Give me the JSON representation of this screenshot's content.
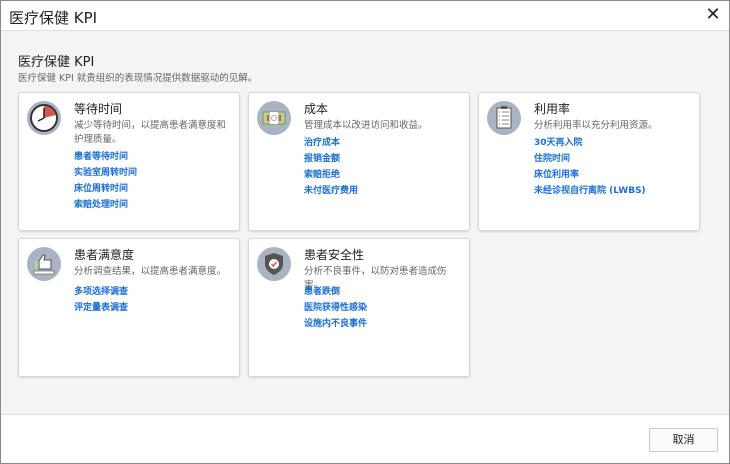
{
  "window": {
    "title": "医疗保健 KPI",
    "close_icon": "close-icon"
  },
  "header": {
    "title": "医疗保健 KPI",
    "subtitle": "医疗保健 KPI 就贵组织的表现情况提供数据驱动的见解。"
  },
  "cards": [
    {
      "title": "等待时间",
      "description": "减少等待时间，以提高患者满意度和护理质量。",
      "icon": "clock-icon",
      "links": [
        "患者等待时间",
        "实验室周转时间",
        "床位周转时间",
        "索赔处理时间"
      ]
    },
    {
      "title": "成本",
      "description": "管理成本以改进访问和收益。",
      "icon": "money-icon",
      "links": [
        "治疗成本",
        "报销金额",
        "索赔拒绝",
        "未付医疗费用"
      ]
    },
    {
      "title": "利用率",
      "description": "分析利用率以充分利用资源。",
      "icon": "clipboard-icon",
      "links": [
        "30天再入院",
        "住院时间",
        "床位利用率",
        "未经诊视自行离院 (LWBS)"
      ]
    },
    {
      "title": "患者满意度",
      "description": "分析调查结果，以提高患者满意度。",
      "icon": "thumbs-up-icon",
      "links": [
        "多项选择调查",
        "评定量表调查"
      ]
    },
    {
      "title": "患者安全性",
      "description": "分析不良事件，以防对患者造成伤害。",
      "icon": "shield-check-icon",
      "links": [
        "患者跌倒",
        "医院获得性感染",
        "设施内不良事件"
      ]
    }
  ],
  "footer": {
    "cancel_label": "取消"
  }
}
